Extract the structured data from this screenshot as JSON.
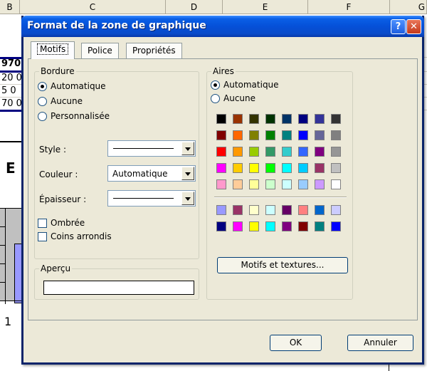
{
  "background": {
    "columns": [
      "B",
      "C",
      "D",
      "E",
      "F",
      "G"
    ],
    "cell_fragments": [
      "970",
      "20 0",
      "5 0",
      "70 0"
    ],
    "bold_fragment": "E",
    "axis_fragment": "1"
  },
  "dialog": {
    "title": "Format de la zone de graphique",
    "help_label": "?",
    "close_label": "✕",
    "tabs": [
      {
        "label": "Motifs",
        "active": true
      },
      {
        "label": "Police",
        "active": false
      },
      {
        "label": "Propriétés",
        "active": false
      }
    ],
    "border": {
      "legend": "Bordure",
      "options": [
        {
          "label": "Automatique",
          "checked": true
        },
        {
          "label": "Aucune",
          "checked": false
        },
        {
          "label": "Personnalisée",
          "checked": false
        }
      ],
      "style_label": "Style :",
      "color_label": "Couleur :",
      "color_value": "Automatique",
      "weight_label": "Épaisseur :",
      "shadow_label": "Ombrée",
      "rounded_label": "Coins arrondis",
      "shadow_checked": false,
      "rounded_checked": false
    },
    "preview": {
      "legend": "Aperçu"
    },
    "area": {
      "legend": "Aires",
      "options": [
        {
          "label": "Automatique",
          "checked": true
        },
        {
          "label": "Aucune",
          "checked": false
        }
      ],
      "palette_main": [
        [
          "#000000",
          "#993300",
          "#333300",
          "#003300",
          "#003366",
          "#000080",
          "#333399",
          "#333333"
        ],
        [
          "#800000",
          "#ff6600",
          "#808000",
          "#008000",
          "#008080",
          "#0000ff",
          "#666699",
          "#808080"
        ],
        [
          "#ff0000",
          "#ff9900",
          "#99cc00",
          "#339966",
          "#33cccc",
          "#3366ff",
          "#800080",
          "#969696"
        ],
        [
          "#ff00ff",
          "#ffcc00",
          "#ffff00",
          "#00ff00",
          "#00ffff",
          "#00ccff",
          "#993366",
          "#c0c0c0"
        ],
        [
          "#ff99cc",
          "#ffcc99",
          "#ffff99",
          "#ccffcc",
          "#ccffff",
          "#99ccff",
          "#cc99ff",
          "#ffffff"
        ]
      ],
      "palette_extra": [
        [
          "#9999ff",
          "#993366",
          "#ffffcc",
          "#ccffff",
          "#660066",
          "#ff8080",
          "#0066cc",
          "#ccccff"
        ],
        [
          "#000080",
          "#ff00ff",
          "#ffff00",
          "#00ffff",
          "#800080",
          "#800000",
          "#008080",
          "#0000ff"
        ]
      ],
      "fill_effects_label": "Motifs et textures..."
    },
    "buttons": {
      "ok": "OK",
      "cancel": "Annuler"
    }
  }
}
